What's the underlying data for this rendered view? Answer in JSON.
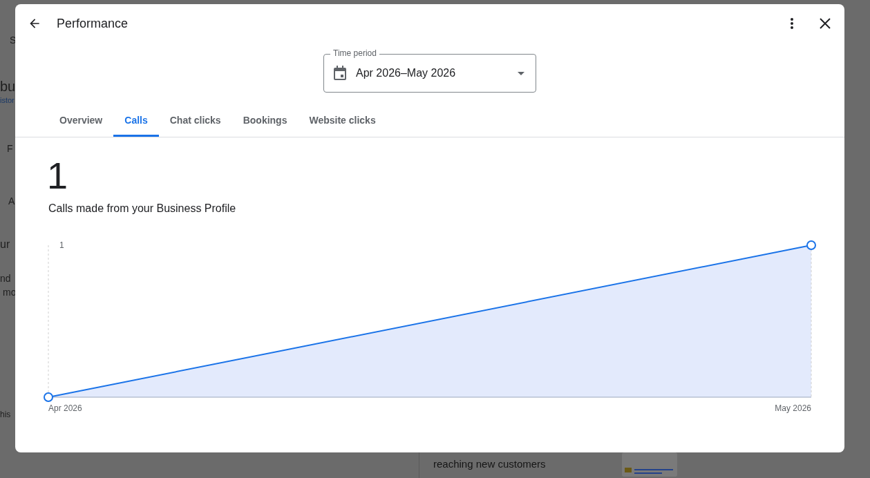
{
  "background_page": {
    "left_fragments": [
      {
        "text": "S",
        "kind": "plain"
      },
      {
        "text": "bu",
        "kind": "heading"
      },
      {
        "text": "istor",
        "kind": "link"
      },
      {
        "text": "F",
        "kind": "plain"
      },
      {
        "text": "A",
        "kind": "plain"
      },
      {
        "text": "ur",
        "kind": "heading"
      },
      {
        "text": "nd",
        "kind": "plain"
      },
      {
        "text": "mo",
        "kind": "plain"
      },
      {
        "text": "his",
        "kind": "small"
      }
    ],
    "bottom_text": "reaching new customers"
  },
  "dialog": {
    "title": "Performance",
    "time_period": {
      "label": "Time period",
      "value": "Apr 2026–May 2026"
    },
    "tabs": [
      {
        "label": "Overview",
        "selected": false
      },
      {
        "label": "Calls",
        "selected": true
      },
      {
        "label": "Chat clicks",
        "selected": false
      },
      {
        "label": "Bookings",
        "selected": false
      },
      {
        "label": "Website clicks",
        "selected": false
      }
    ],
    "total": "1",
    "caption": "Calls made from your Business Profile",
    "chart": {
      "y_tick": "1",
      "x_labels": [
        "Apr 2026",
        "May 2026"
      ]
    }
  }
}
